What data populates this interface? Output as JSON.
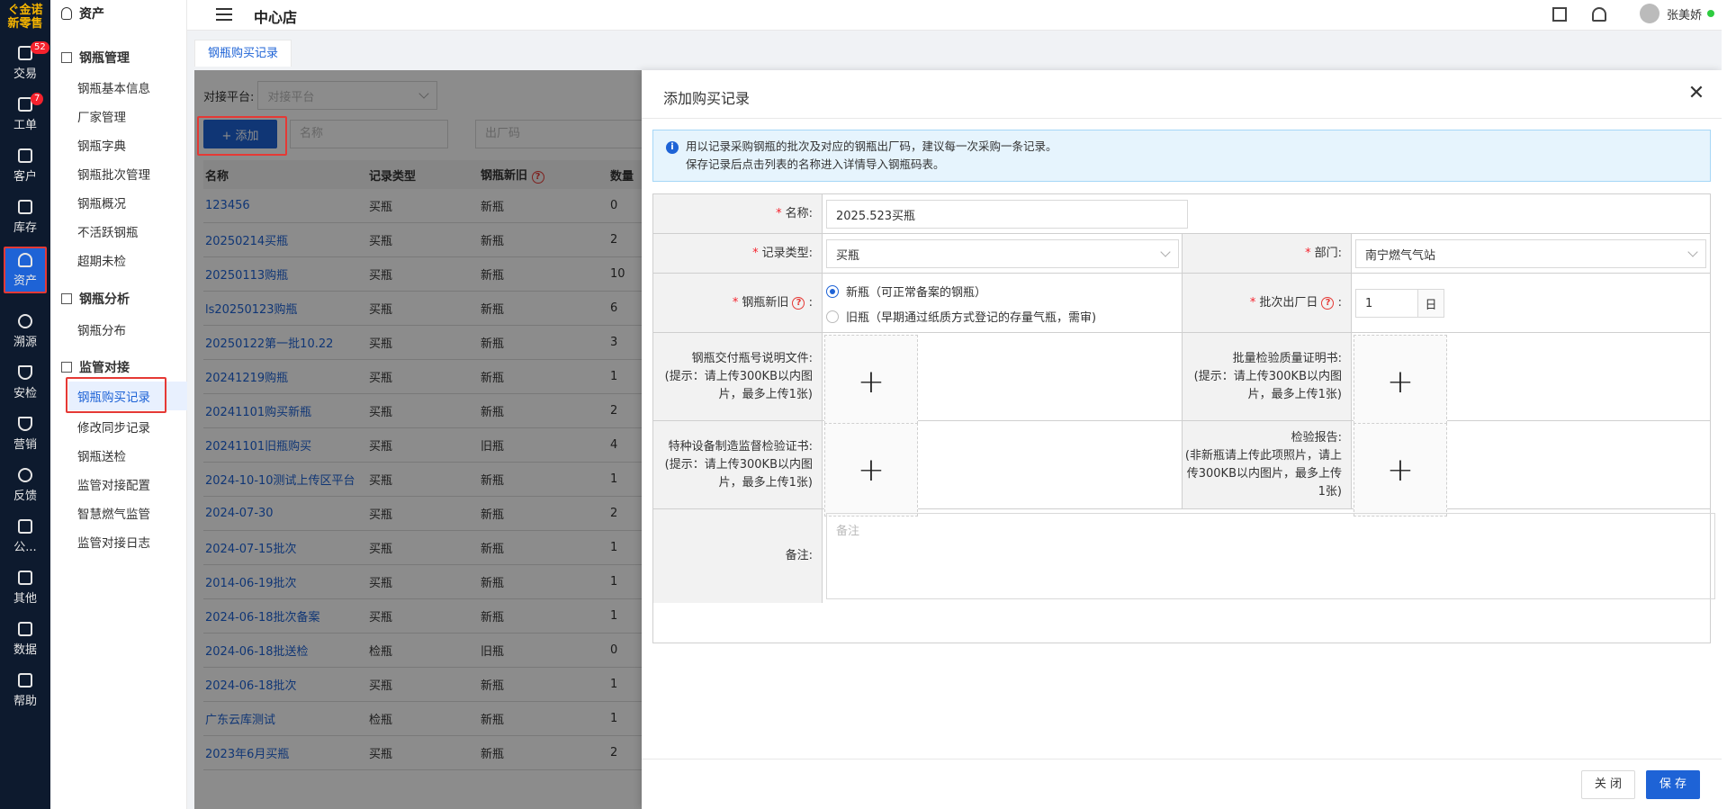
{
  "brand": {
    "line1": "ぐ金诺",
    "line2": "新零售"
  },
  "rail": [
    {
      "label": "交易",
      "badge": "52"
    },
    {
      "label": "工单",
      "badge": "7"
    },
    {
      "label": "客户"
    },
    {
      "label": "库存"
    },
    {
      "label": "资产"
    },
    {
      "label": "溯源"
    },
    {
      "label": "安检"
    },
    {
      "label": "营销"
    },
    {
      "label": "反馈"
    },
    {
      "label": "公..."
    },
    {
      "label": "其他"
    },
    {
      "label": "数据"
    },
    {
      "label": "帮助"
    }
  ],
  "sidebar": {
    "title": "资产",
    "groups": [
      {
        "label": "钢瓶管理",
        "items": [
          "钢瓶基本信息",
          "厂家管理",
          "钢瓶字典",
          "钢瓶批次管理",
          "钢瓶概况",
          "不活跃钢瓶",
          "超期未检"
        ]
      },
      {
        "label": "钢瓶分析",
        "items": [
          "钢瓶分布"
        ]
      },
      {
        "label": "监管对接",
        "items": [
          "钢瓶购买记录",
          "修改同步记录",
          "钢瓶送检",
          "监管对接配置",
          "智慧燃气监管",
          "监管对接日志"
        ]
      }
    ]
  },
  "header": {
    "store": "中心店",
    "user": "张美娇"
  },
  "tab": "钢瓶购买记录",
  "list": {
    "platform_label": "对接平台:",
    "platform_placeholder": "对接平台",
    "add_label": "+ 添加",
    "name_placeholder": "名称",
    "code_placeholder": "出厂码",
    "columns": [
      "名称",
      "记录类型",
      "钢瓶新旧",
      "数量"
    ],
    "rows": [
      [
        "123456",
        "买瓶",
        "新瓶",
        "0"
      ],
      [
        "20250214买瓶",
        "买瓶",
        "新瓶",
        "2"
      ],
      [
        "20250113购瓶",
        "买瓶",
        "新瓶",
        "10"
      ],
      [
        "ls20250123购瓶",
        "买瓶",
        "新瓶",
        "6"
      ],
      [
        "20250122第一批10.22",
        "买瓶",
        "新瓶",
        "3"
      ],
      [
        "20241219购瓶",
        "买瓶",
        "新瓶",
        "1"
      ],
      [
        "20241101购买新瓶",
        "买瓶",
        "新瓶",
        "2"
      ],
      [
        "20241101旧瓶购买",
        "买瓶",
        "旧瓶",
        "4"
      ],
      [
        "2024-10-10测试上传区平台",
        "买瓶",
        "新瓶",
        "1"
      ],
      [
        "2024-07-30",
        "买瓶",
        "新瓶",
        "2"
      ],
      [
        "2024-07-15批次",
        "买瓶",
        "新瓶",
        "1"
      ],
      [
        "2014-06-19批次",
        "买瓶",
        "新瓶",
        "1"
      ],
      [
        "2024-06-18批次备案",
        "买瓶",
        "新瓶",
        "1"
      ],
      [
        "2024-06-18批送检",
        "检瓶",
        "旧瓶",
        "0"
      ],
      [
        "2024-06-18批次",
        "买瓶",
        "新瓶",
        "1"
      ],
      [
        "广东云库测试",
        "检瓶",
        "新瓶",
        "1"
      ],
      [
        "2023年6月买瓶",
        "买瓶",
        "新瓶",
        "2"
      ]
    ]
  },
  "drawer": {
    "title": "添加购买记录",
    "alert_line1": "用以记录采购钢瓶的批次及对应的钢瓶出厂码，建议每一次采购一条记录。",
    "alert_line2": "保存记录后点击列表的名称进入详情导入钢瓶码表。",
    "name_label": "名称:",
    "name_value": "2025.523买瓶",
    "type_label": "记录类型:",
    "type_value": "买瓶",
    "dept_label": "部门:",
    "dept_value": "南宁燃气气站",
    "newold_label": "钢瓶新旧",
    "radio_new": "新瓶（可正常备案的钢瓶）",
    "radio_old": "旧瓶（早期通过纸质方式登记的存量气瓶，需审)",
    "batch_label": "批次出厂日",
    "batch_value": "1",
    "batch_unit": "日",
    "upload1_label": "钢瓶交付瓶号说明文件:\n(提示：请上传300KB以内图片，最多上传1张)",
    "upload2_label": "批量检验质量证明书:\n(提示：请上传300KB以内图片，最多上传1张)",
    "upload3_label": "特种设备制造监督检验证书:\n(提示：请上传300KB以内图片，最多上传1张)",
    "upload4_label": "检验报告:\n(非新瓶请上传此项照片，请上传300KB以内图片，最多上传1张)",
    "remark_label": "备注:",
    "remark_placeholder": "备注",
    "close_btn": "关 闭",
    "save_btn": "保 存"
  }
}
